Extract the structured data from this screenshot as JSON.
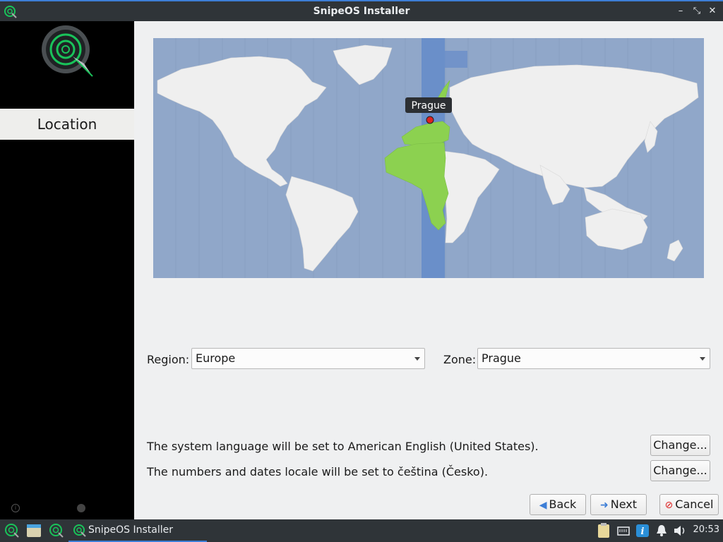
{
  "window": {
    "title": "SnipeOS Installer",
    "controls": [
      "minimize-icon",
      "maximize-icon",
      "close-icon"
    ]
  },
  "sidebar": {
    "current_step": "Location"
  },
  "map": {
    "selected_city": "Prague",
    "highlight_color": "#8cd150",
    "timezone_band_color": "#6a8fc9",
    "ocean_color": "#90a7c9",
    "land_color": "#efefef"
  },
  "region": {
    "label": "Region:",
    "value": "Europe"
  },
  "zone": {
    "label": "Zone:",
    "value": "Prague"
  },
  "language": {
    "text": "The system language will be set to American English (United States).",
    "button": "Change..."
  },
  "locale": {
    "text": "The numbers and dates locale will be set to čeština (Česko).",
    "button": "Change..."
  },
  "nav": {
    "back": "Back",
    "next": "Next",
    "cancel": "Cancel"
  },
  "taskbar": {
    "task_label": "SnipeOS Installer",
    "clock": "20:53"
  },
  "colors": {
    "accent": "#3d7ed6",
    "logo_green": "#19c35a"
  }
}
